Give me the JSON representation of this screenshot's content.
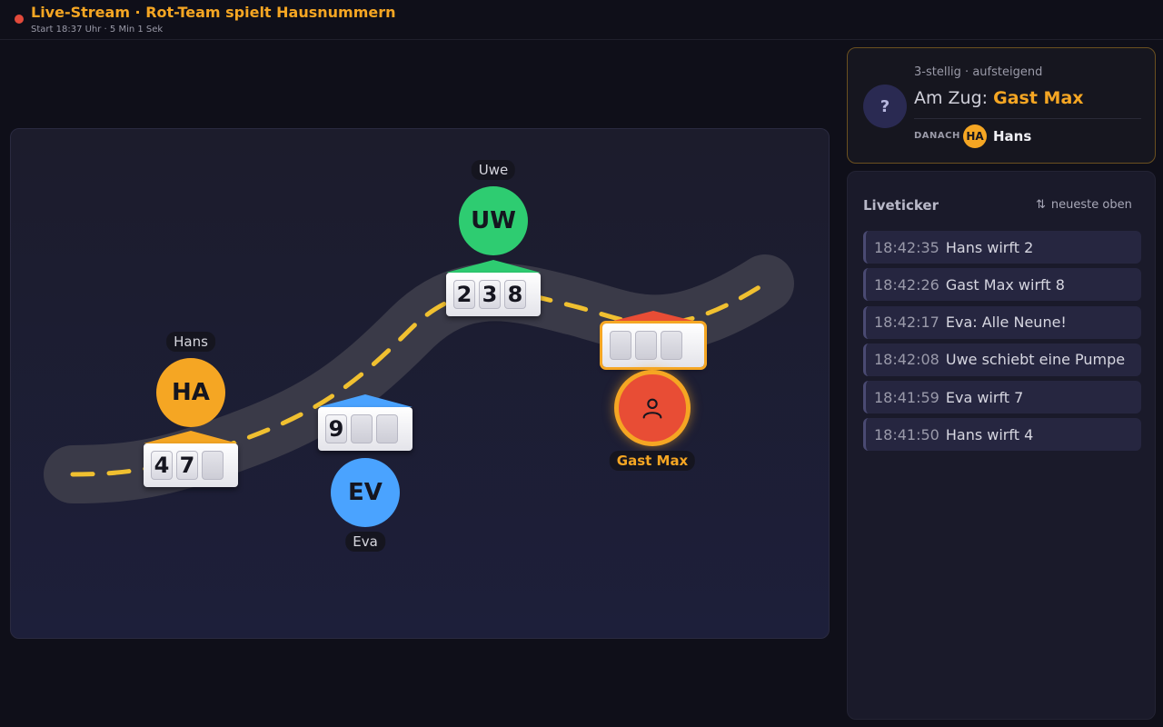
{
  "header": {
    "title": "Live-Stream · Rot-Team spielt Hausnummern",
    "subtitle": "Start 18:37 Uhr · 5 Min 1 Sek"
  },
  "board": {
    "players": [
      {
        "id": "hans",
        "name": "Hans",
        "initials": "HA",
        "color": "#f5a623",
        "digits": [
          "4",
          "7",
          ""
        ]
      },
      {
        "id": "eva",
        "name": "Eva",
        "initials": "EV",
        "color": "#4aa3ff",
        "digits": [
          "9",
          "",
          ""
        ]
      },
      {
        "id": "uwe",
        "name": "Uwe",
        "initials": "UW",
        "color": "#2ecc71",
        "digits": [
          "2",
          "3",
          "8"
        ]
      },
      {
        "id": "gastmax",
        "name": "Gast Max",
        "initials": "",
        "color": "#e84d35",
        "icon": "person-icon",
        "digits": [
          "",
          "",
          ""
        ]
      }
    ]
  },
  "turn": {
    "icon": "?",
    "mode": "3-stellig · aufsteigend",
    "prefix": "Am Zug: ",
    "current": "Gast Max",
    "next_label": "DANACH",
    "next_initials": "HA",
    "next_name": "Hans"
  },
  "ticker": {
    "title": "Liveticker",
    "sort_icon": "⇅",
    "sort_label": "neueste oben",
    "items": [
      {
        "time": "18:42:35",
        "msg": "Hans wirft 2"
      },
      {
        "time": "18:42:26",
        "msg": "Gast Max wirft 8"
      },
      {
        "time": "18:42:17",
        "msg": "Eva: Alle Neune!"
      },
      {
        "time": "18:42:08",
        "msg": "Uwe schiebt eine Pumpe"
      },
      {
        "time": "18:41:59",
        "msg": "Eva wirft 7"
      },
      {
        "time": "18:41:50",
        "msg": "Hans wirft 4"
      }
    ]
  },
  "colors": {
    "accent": "#f5a623",
    "road_dash": "#f0c030"
  }
}
